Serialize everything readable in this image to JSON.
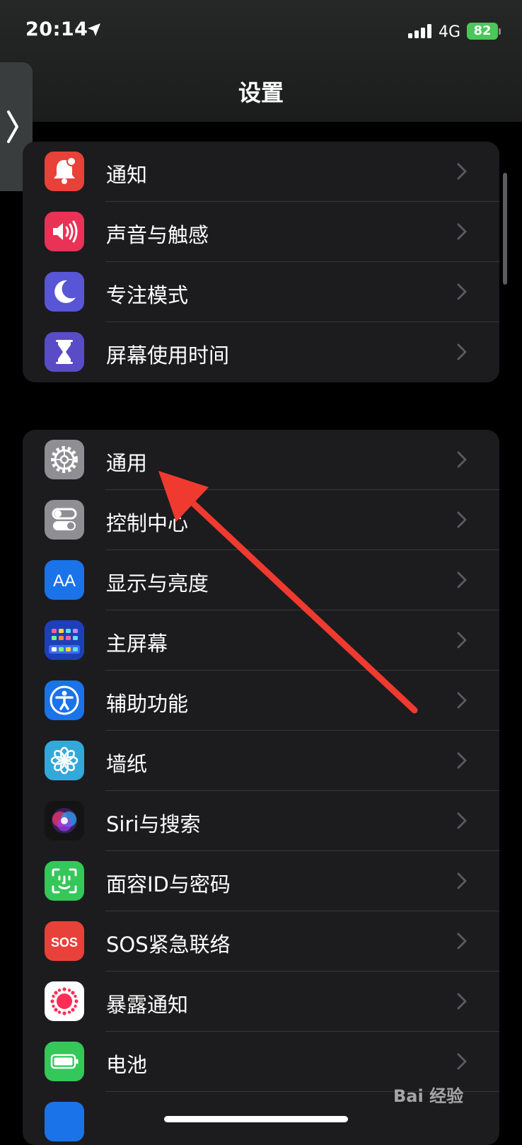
{
  "status_bar": {
    "time": "20:14",
    "network": "4G",
    "battery": "82"
  },
  "page": {
    "title": "设置"
  },
  "groups": [
    {
      "items": [
        {
          "label": "通知",
          "icon": "bell-icon",
          "color": "#e8413a"
        },
        {
          "label": "声音与触感",
          "icon": "speaker-icon",
          "color": "#e93256"
        },
        {
          "label": "专注模式",
          "icon": "moon-icon",
          "color": "#5856d6"
        },
        {
          "label": "屏幕使用时间",
          "icon": "hourglass-icon",
          "color": "#5a4bc7"
        }
      ]
    },
    {
      "items": [
        {
          "label": "通用",
          "icon": "gear-icon",
          "color": "#8e8e93"
        },
        {
          "label": "控制中心",
          "icon": "toggles-icon",
          "color": "#8e8e93"
        },
        {
          "label": "显示与亮度",
          "icon": "text-size-icon",
          "color": "#1a73e8"
        },
        {
          "label": "主屏幕",
          "icon": "home-screen-grid-icon",
          "color": "#2a57d6"
        },
        {
          "label": "辅助功能",
          "icon": "accessibility-icon",
          "color": "#1a73e8"
        },
        {
          "label": "墙纸",
          "icon": "flower-icon",
          "color": "#34a8d8"
        },
        {
          "label": "Siri与搜索",
          "icon": "siri-icon",
          "color": "#141414"
        },
        {
          "label": "面容ID与密码",
          "icon": "face-id-icon",
          "color": "#34c759"
        },
        {
          "label": "SOS紧急联络",
          "icon": "sos-icon",
          "color": "#e8413a"
        },
        {
          "label": "暴露通知",
          "icon": "exposure-icon",
          "color": "#ffffff"
        },
        {
          "label": "电池",
          "icon": "battery-icon",
          "color": "#34c759"
        }
      ]
    }
  ],
  "icon_text": {
    "sos": "SOS",
    "aa": "AA"
  },
  "watermark": "Bai 经验"
}
